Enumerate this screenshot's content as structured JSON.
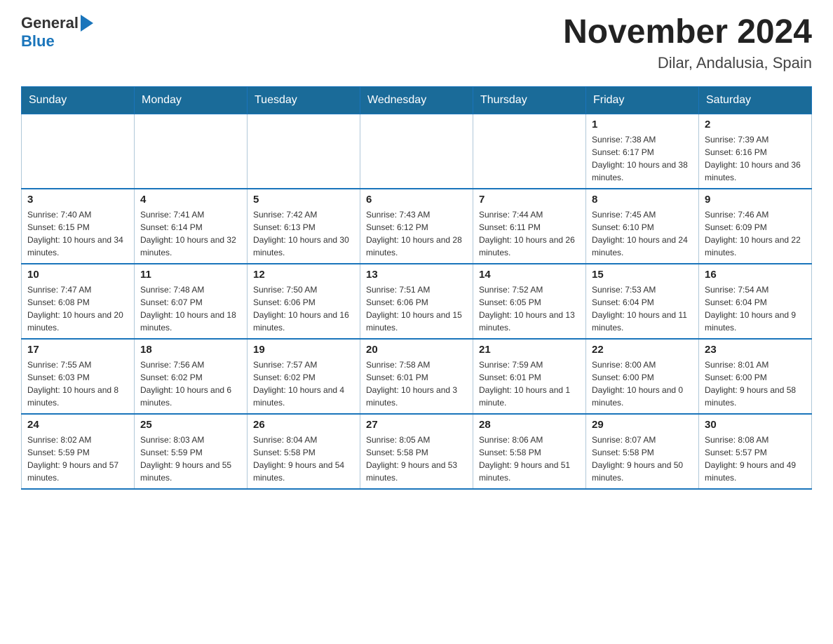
{
  "header": {
    "logo_general": "General",
    "logo_blue": "Blue",
    "month_title": "November 2024",
    "location": "Dilar, Andalusia, Spain"
  },
  "days_of_week": [
    "Sunday",
    "Monday",
    "Tuesday",
    "Wednesday",
    "Thursday",
    "Friday",
    "Saturday"
  ],
  "weeks": [
    [
      {
        "day": "",
        "info": ""
      },
      {
        "day": "",
        "info": ""
      },
      {
        "day": "",
        "info": ""
      },
      {
        "day": "",
        "info": ""
      },
      {
        "day": "",
        "info": ""
      },
      {
        "day": "1",
        "info": "Sunrise: 7:38 AM\nSunset: 6:17 PM\nDaylight: 10 hours and 38 minutes."
      },
      {
        "day": "2",
        "info": "Sunrise: 7:39 AM\nSunset: 6:16 PM\nDaylight: 10 hours and 36 minutes."
      }
    ],
    [
      {
        "day": "3",
        "info": "Sunrise: 7:40 AM\nSunset: 6:15 PM\nDaylight: 10 hours and 34 minutes."
      },
      {
        "day": "4",
        "info": "Sunrise: 7:41 AM\nSunset: 6:14 PM\nDaylight: 10 hours and 32 minutes."
      },
      {
        "day": "5",
        "info": "Sunrise: 7:42 AM\nSunset: 6:13 PM\nDaylight: 10 hours and 30 minutes."
      },
      {
        "day": "6",
        "info": "Sunrise: 7:43 AM\nSunset: 6:12 PM\nDaylight: 10 hours and 28 minutes."
      },
      {
        "day": "7",
        "info": "Sunrise: 7:44 AM\nSunset: 6:11 PM\nDaylight: 10 hours and 26 minutes."
      },
      {
        "day": "8",
        "info": "Sunrise: 7:45 AM\nSunset: 6:10 PM\nDaylight: 10 hours and 24 minutes."
      },
      {
        "day": "9",
        "info": "Sunrise: 7:46 AM\nSunset: 6:09 PM\nDaylight: 10 hours and 22 minutes."
      }
    ],
    [
      {
        "day": "10",
        "info": "Sunrise: 7:47 AM\nSunset: 6:08 PM\nDaylight: 10 hours and 20 minutes."
      },
      {
        "day": "11",
        "info": "Sunrise: 7:48 AM\nSunset: 6:07 PM\nDaylight: 10 hours and 18 minutes."
      },
      {
        "day": "12",
        "info": "Sunrise: 7:50 AM\nSunset: 6:06 PM\nDaylight: 10 hours and 16 minutes."
      },
      {
        "day": "13",
        "info": "Sunrise: 7:51 AM\nSunset: 6:06 PM\nDaylight: 10 hours and 15 minutes."
      },
      {
        "day": "14",
        "info": "Sunrise: 7:52 AM\nSunset: 6:05 PM\nDaylight: 10 hours and 13 minutes."
      },
      {
        "day": "15",
        "info": "Sunrise: 7:53 AM\nSunset: 6:04 PM\nDaylight: 10 hours and 11 minutes."
      },
      {
        "day": "16",
        "info": "Sunrise: 7:54 AM\nSunset: 6:04 PM\nDaylight: 10 hours and 9 minutes."
      }
    ],
    [
      {
        "day": "17",
        "info": "Sunrise: 7:55 AM\nSunset: 6:03 PM\nDaylight: 10 hours and 8 minutes."
      },
      {
        "day": "18",
        "info": "Sunrise: 7:56 AM\nSunset: 6:02 PM\nDaylight: 10 hours and 6 minutes."
      },
      {
        "day": "19",
        "info": "Sunrise: 7:57 AM\nSunset: 6:02 PM\nDaylight: 10 hours and 4 minutes."
      },
      {
        "day": "20",
        "info": "Sunrise: 7:58 AM\nSunset: 6:01 PM\nDaylight: 10 hours and 3 minutes."
      },
      {
        "day": "21",
        "info": "Sunrise: 7:59 AM\nSunset: 6:01 PM\nDaylight: 10 hours and 1 minute."
      },
      {
        "day": "22",
        "info": "Sunrise: 8:00 AM\nSunset: 6:00 PM\nDaylight: 10 hours and 0 minutes."
      },
      {
        "day": "23",
        "info": "Sunrise: 8:01 AM\nSunset: 6:00 PM\nDaylight: 9 hours and 58 minutes."
      }
    ],
    [
      {
        "day": "24",
        "info": "Sunrise: 8:02 AM\nSunset: 5:59 PM\nDaylight: 9 hours and 57 minutes."
      },
      {
        "day": "25",
        "info": "Sunrise: 8:03 AM\nSunset: 5:59 PM\nDaylight: 9 hours and 55 minutes."
      },
      {
        "day": "26",
        "info": "Sunrise: 8:04 AM\nSunset: 5:58 PM\nDaylight: 9 hours and 54 minutes."
      },
      {
        "day": "27",
        "info": "Sunrise: 8:05 AM\nSunset: 5:58 PM\nDaylight: 9 hours and 53 minutes."
      },
      {
        "day": "28",
        "info": "Sunrise: 8:06 AM\nSunset: 5:58 PM\nDaylight: 9 hours and 51 minutes."
      },
      {
        "day": "29",
        "info": "Sunrise: 8:07 AM\nSunset: 5:58 PM\nDaylight: 9 hours and 50 minutes."
      },
      {
        "day": "30",
        "info": "Sunrise: 8:08 AM\nSunset: 5:57 PM\nDaylight: 9 hours and 49 minutes."
      }
    ]
  ]
}
